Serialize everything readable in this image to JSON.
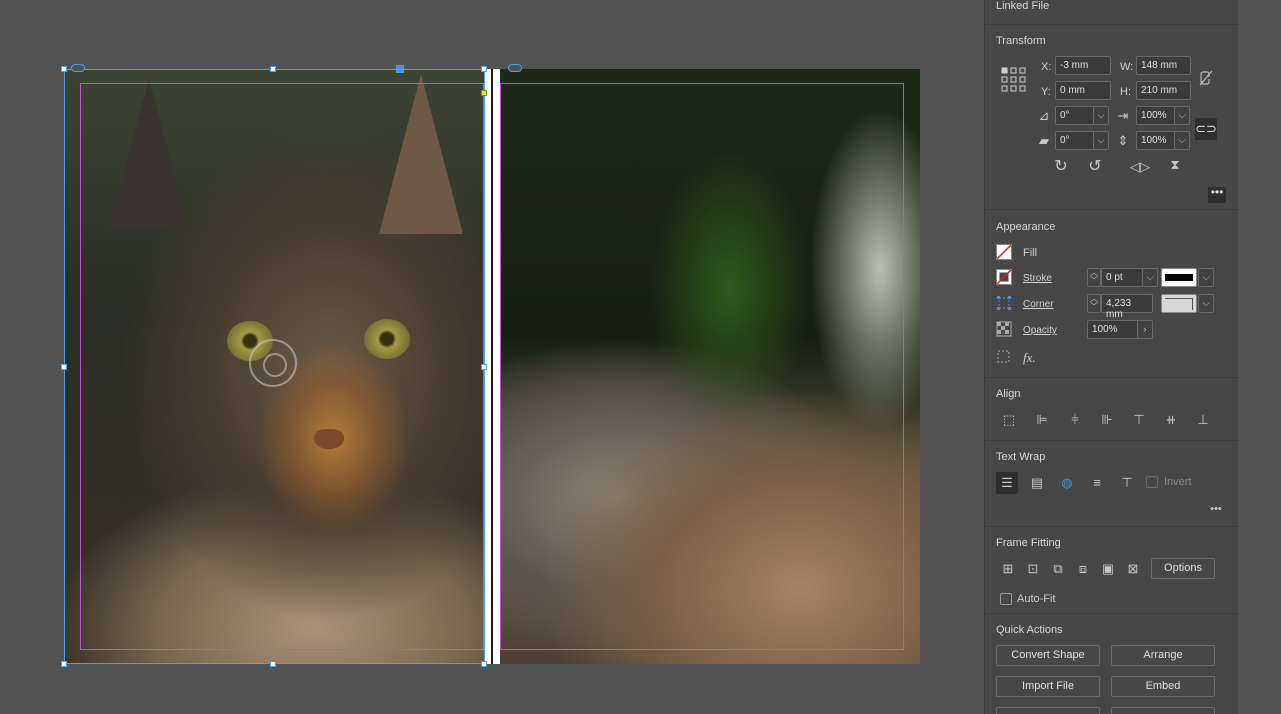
{
  "panel": {
    "linked_file_title": "Linked File",
    "transform": {
      "title": "Transform",
      "x_label": "X:",
      "x_value": "-3 mm",
      "y_label": "Y:",
      "y_value": "0 mm",
      "w_label": "W:",
      "w_value": "148 mm",
      "h_label": "H:",
      "h_value": "210 mm",
      "rotate_value": "0°",
      "shear_value": "0°",
      "scale_x_value": "100%",
      "scale_y_value": "100%"
    },
    "appearance": {
      "title": "Appearance",
      "fill_label": "Fill",
      "stroke_label": "Stroke",
      "stroke_value": "0 pt",
      "corner_label": "Corner",
      "corner_value": "4,233 mm",
      "opacity_label": "Opacity",
      "opacity_value": "100%",
      "fx_label": "fx."
    },
    "align": {
      "title": "Align"
    },
    "text_wrap": {
      "title": "Text Wrap",
      "invert_label": "Invert"
    },
    "frame_fitting": {
      "title": "Frame Fitting",
      "options_label": "Options",
      "autofit_label": "Auto-Fit"
    },
    "quick_actions": {
      "title": "Quick Actions",
      "convert_shape_label": "Convert Shape",
      "arrange_label": "Arrange",
      "import_file_label": "Import File",
      "embed_label": "Embed"
    }
  },
  "colors": {
    "accent": "#3fc4c2",
    "selection": "#4aa3e8",
    "margin_guide": "#c84fd6",
    "panel_bg": "#474747",
    "pasteboard": "#535353"
  },
  "icons": {
    "reference_point": "reference-point-icon",
    "constrain": "constrain-proportions-icon",
    "rotate_cw": "rotate-clockwise-icon",
    "rotate_ccw": "rotate-counterclockwise-icon",
    "flip_h": "flip-horizontal-icon",
    "flip_v": "flip-vertical-icon"
  }
}
